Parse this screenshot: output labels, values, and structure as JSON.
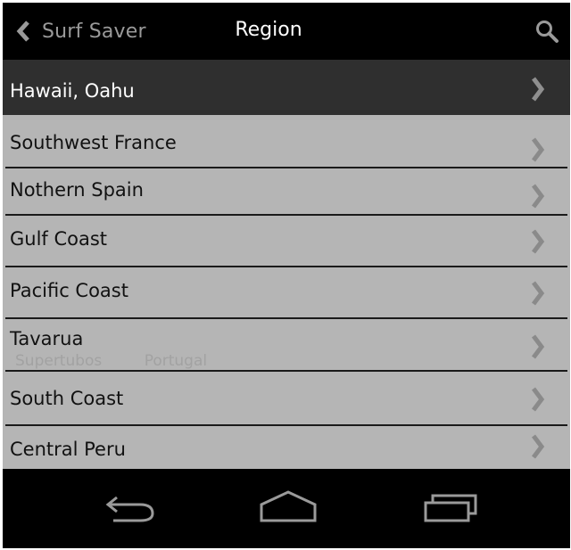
{
  "header": {
    "app_title": "Surf Saver",
    "page_title": "Region",
    "back_icon": "chevron-left-icon",
    "search_icon": "search-icon"
  },
  "regions": [
    {
      "label": "Hawaii, Oahu",
      "selected": true
    },
    {
      "label": "Southwest France",
      "selected": false
    },
    {
      "label": "Nothern Spain",
      "selected": false
    },
    {
      "label": "Gulf Coast",
      "selected": false
    },
    {
      "label": "Pacific Coast",
      "selected": false
    },
    {
      "label": "Tavarua",
      "selected": false
    },
    {
      "label": "South Coast",
      "selected": false
    },
    {
      "label": "Central Peru",
      "selected": false
    }
  ],
  "ghost_text": {
    "left": "Supertubos",
    "right": "Portugal"
  },
  "nav": {
    "back_icon": "back-arrow-icon",
    "home_icon": "home-icon",
    "recents_icon": "recent-apps-icon"
  },
  "colors": {
    "list_bg": "#b5b5b5",
    "selected_bg": "#2f2f2f",
    "bar_bg": "#000000",
    "nav_icon": "#9a9a9a"
  }
}
